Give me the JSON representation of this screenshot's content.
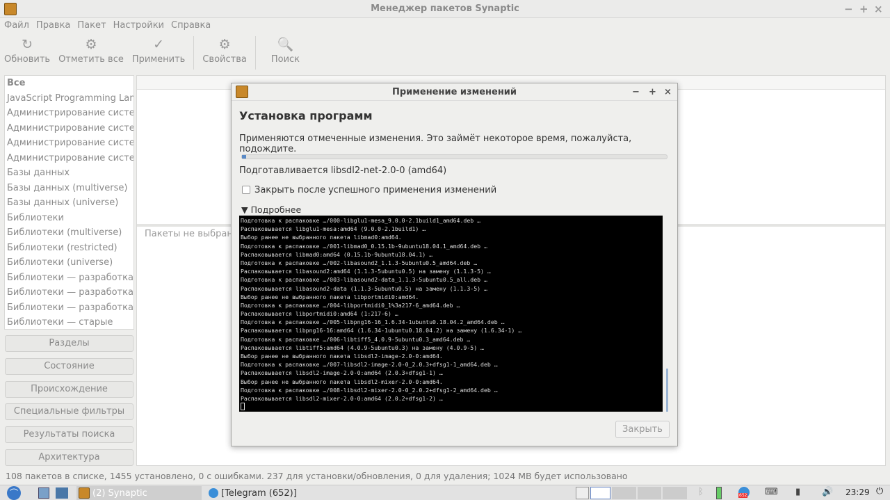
{
  "window": {
    "title": "Менеджер пакетов Synaptic",
    "controls": [
      "−",
      "+",
      "×"
    ]
  },
  "menu": [
    "Файл",
    "Правка",
    "Пакет",
    "Настройки",
    "Справка"
  ],
  "toolbar": [
    {
      "label": "Обновить",
      "icon": "↻"
    },
    {
      "label": "Отметить все",
      "icon": "⚙"
    },
    {
      "label": "Применить",
      "icon": "✓"
    },
    {
      "label": "Свойства",
      "icon": "⚙"
    },
    {
      "label": "Поиск",
      "icon": "🔍"
    }
  ],
  "sidebar": {
    "items": [
      "Все",
      "JavaScript Programming Lang",
      "Администрирование систем",
      "Администрирование систем",
      "Администрирование систем",
      "Администрирование систем",
      "Базы данных",
      "Базы данных (multiverse)",
      "Базы данных (universe)",
      "Библиотеки",
      "Библиотеки (multiverse)",
      "Библиотеки (restricted)",
      "Библиотеки (universe)",
      "Библиотеки — разработка",
      "Библиотеки — разработка (",
      "Библиотеки — разработка (",
      "Библиотеки — старые"
    ],
    "buttons": [
      "Разделы",
      "Состояние",
      "Происхождение",
      "Специальные фильтры",
      "Результаты поиска",
      "Архитектура"
    ]
  },
  "main": {
    "no_selection": "Пакеты не выбраны"
  },
  "status": "108 пакетов в списке, 1455 установлено, 0 с ошибками. 237 для установки/обновления, 0 для удаления; 1024 MB будет использовано",
  "dialog": {
    "title": "Применение изменений",
    "controls": [
      "−",
      "+",
      "×"
    ],
    "heading": "Установка программ",
    "description": "Применяются отмеченные изменения. Это займёт некоторое время, пожалуйста, подождите.",
    "progress": 0.01,
    "current": "Подготавливается libsdl2-net-2.0-0 (amd64)",
    "close_after": "Закрыть после успешного применения изменений",
    "close_after_checked": false,
    "details": "Подробнее",
    "close_button": "Закрыть",
    "terminal": [
      "Подготовка к распаковке …/000-libglu1-mesa_9.0.0-2.1build1_amd64.deb …",
      "Распаковывается libglu1-mesa:amd64 (9.0.0-2.1build1) …",
      "Выбор ранее не выбранного пакета libmad0:amd64.",
      "Подготовка к распаковке …/001-libmad0_0.15.1b-9ubuntu18.04.1_amd64.deb …",
      "Распаковывается libmad0:amd64 (0.15.1b-9ubuntu18.04.1) …",
      "Подготовка к распаковке …/002-libasound2_1.1.3-5ubuntu0.5_amd64.deb …",
      "Распаковывается libasound2:amd64 (1.1.3-5ubuntu0.5) на замену (1.1.3-5) …",
      "Подготовка к распаковке …/003-libasound2-data_1.1.3-5ubuntu0.5_all.deb …",
      "Распаковывается libasound2-data (1.1.3-5ubuntu0.5) на замену (1.1.3-5) …",
      "Выбор ранее не выбранного пакета libportmidi0:amd64.",
      "Подготовка к распаковке …/004-libportmidi0_1%3a217-6_amd64.deb …",
      "Распаковывается libportmidi0:amd64 (1:217-6) …",
      "Подготовка к распаковке …/005-libpng16-16_1.6.34-1ubuntu0.18.04.2_amd64.deb …",
      "Распаковывается libpng16-16:amd64 (1.6.34-1ubuntu0.18.04.2) на замену (1.6.34-1) …",
      "Подготовка к распаковке …/006-libtiff5_4.0.9-5ubuntu0.3_amd64.deb …",
      "Распаковывается libtiff5:amd64 (4.0.9-5ubuntu0.3) на замену (4.0.9-5) …",
      "Выбор ранее не выбранного пакета libsdl2-image-2.0-0:amd64.",
      "Подготовка к распаковке …/007-libsdl2-image-2.0-0_2.0.3+dfsg1-1_amd64.deb …",
      "Распаковывается libsdl2-image-2.0-0:amd64 (2.0.3+dfsg1-1) …",
      "Выбор ранее не выбранного пакета libsdl2-mixer-2.0-0:amd64.",
      "Подготовка к распаковке …/008-libsdl2-mixer-2.0-0_2.0.2+dfsg1-2_amd64.deb …",
      "Распаковывается libsdl2-mixer-2.0-0:amd64 (2.0.2+dfsg1-2) …"
    ]
  },
  "taskbar": {
    "tasks": [
      "(2) Synaptic",
      "[Telegram (652)]"
    ],
    "badge": "652",
    "clock": "23:29"
  }
}
